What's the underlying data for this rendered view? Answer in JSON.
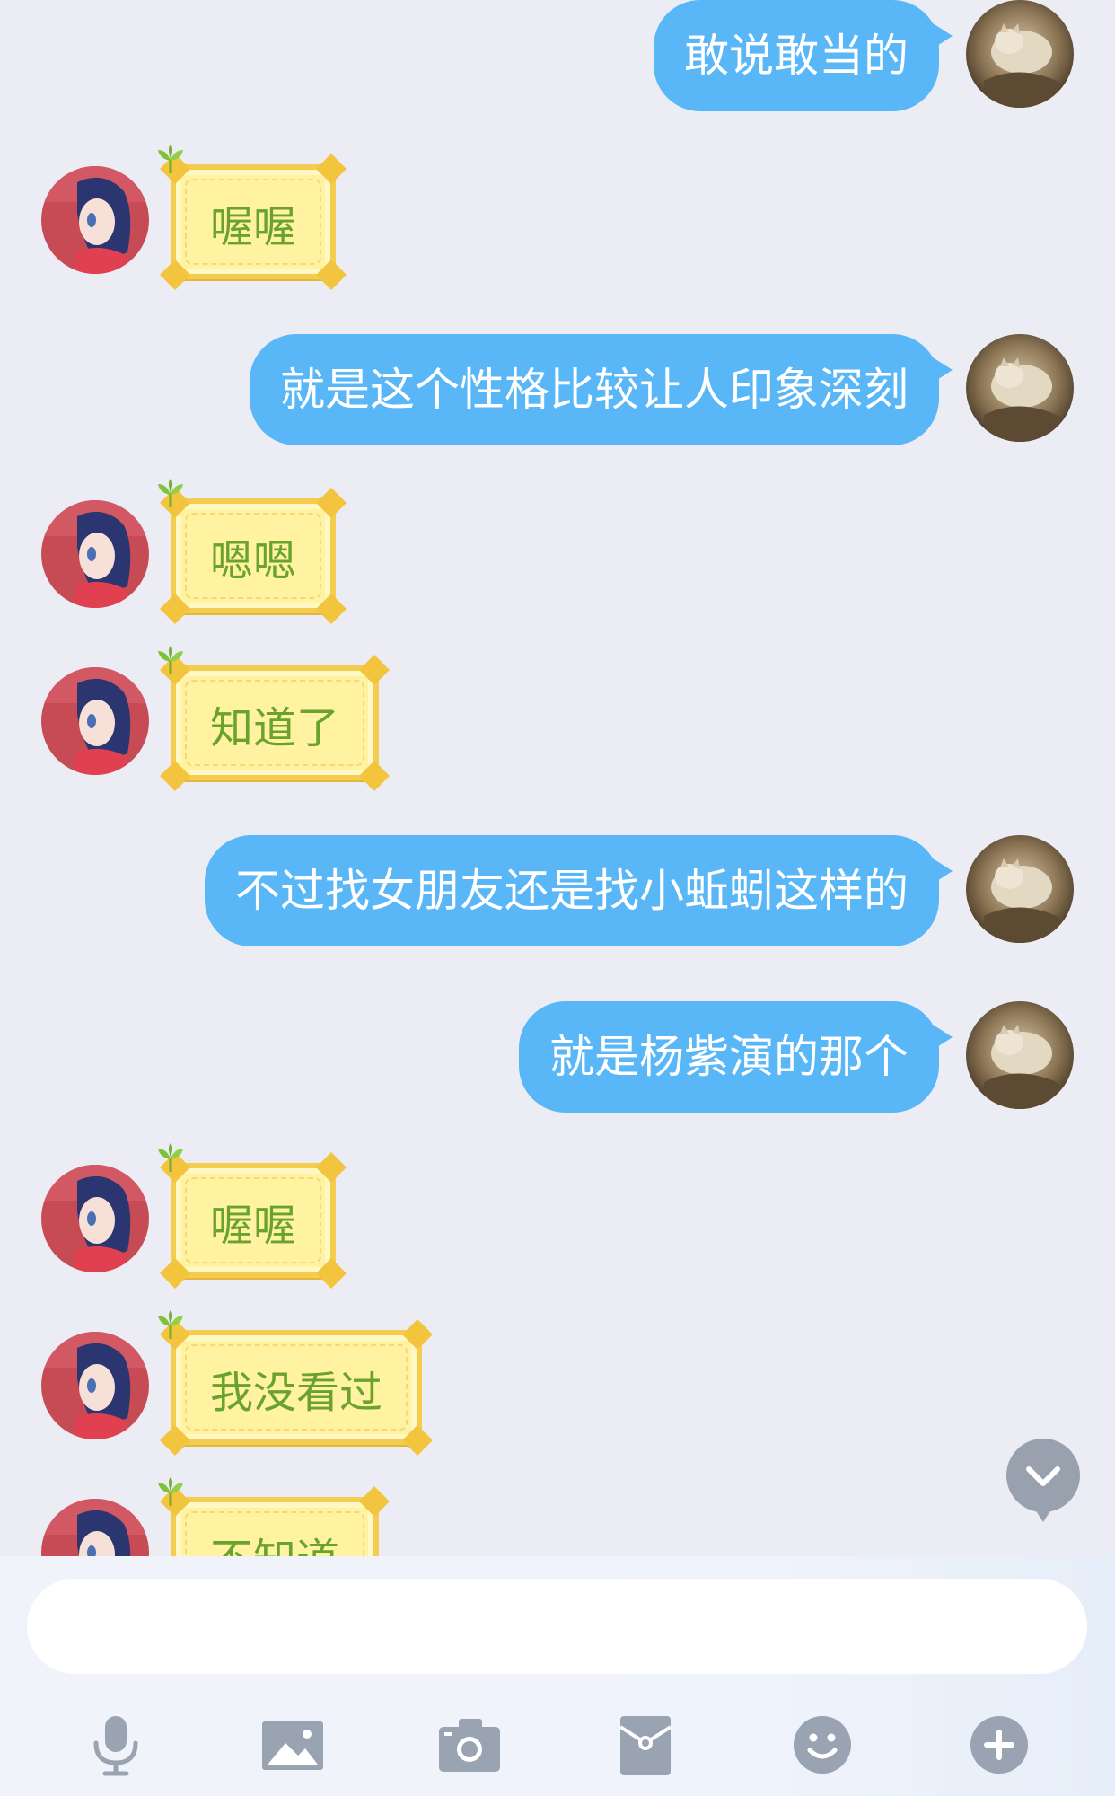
{
  "messages": [
    {
      "side": "out",
      "text": "敢说敢当的"
    },
    {
      "side": "in",
      "text": "喔喔"
    },
    {
      "side": "out",
      "text": "就是这个性格比较让人印象深刻"
    },
    {
      "side": "in",
      "text": "嗯嗯"
    },
    {
      "side": "in",
      "text": "知道了"
    },
    {
      "side": "out",
      "text": "不过找女朋友还是找小蚯蚓这样的"
    },
    {
      "side": "out",
      "text": "就是杨紫演的那个"
    },
    {
      "side": "in",
      "text": "喔喔"
    },
    {
      "side": "in",
      "text": "我没看过"
    },
    {
      "side": "in",
      "text": "不知道"
    }
  ],
  "input": {
    "value": "",
    "placeholder": ""
  },
  "scroll_button": {
    "icon": "chevron-down-icon"
  },
  "toolbar": {
    "items": [
      {
        "name": "voice",
        "icon": "microphone-icon"
      },
      {
        "name": "image",
        "icon": "image-icon"
      },
      {
        "name": "camera",
        "icon": "camera-icon"
      },
      {
        "name": "red-packet",
        "icon": "red-packet-icon"
      },
      {
        "name": "emoji",
        "icon": "smiley-icon"
      },
      {
        "name": "more",
        "icon": "plus-icon"
      }
    ]
  },
  "colors": {
    "background": "#ECECF5",
    "outgoing_bubble": "#59B6F7",
    "outgoing_text": "#FFFFFF",
    "incoming_bubble": "#FFF3A2",
    "incoming_border": "#F4CC4E",
    "incoming_text": "#69A22D",
    "icon_gray": "#9AA3B2"
  }
}
